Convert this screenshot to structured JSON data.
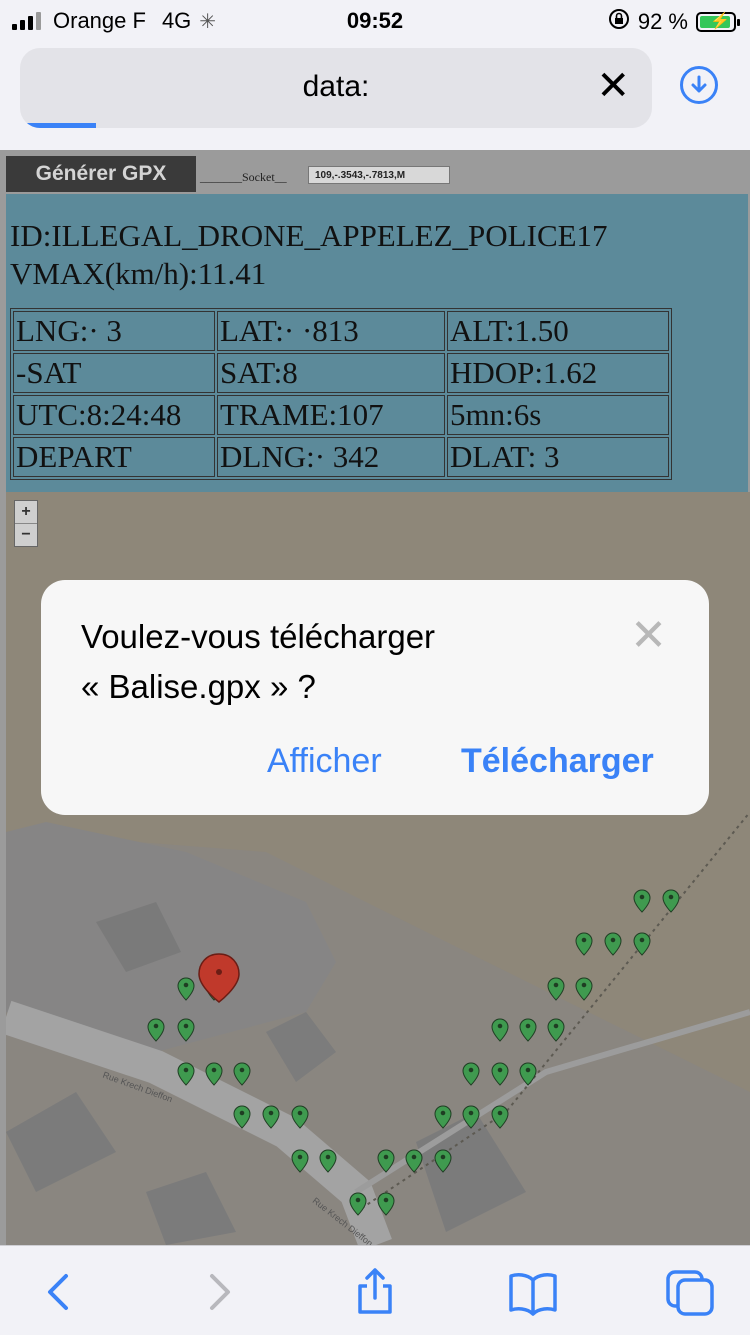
{
  "status_bar": {
    "carrier": "Orange F",
    "network": "4G",
    "time": "09:52",
    "battery_percent": "92 %",
    "battery_level": 0.92,
    "signal_bars": 3
  },
  "browser": {
    "url": "data:",
    "load_progress": 0.12,
    "accent_color": "#3a82f7"
  },
  "page": {
    "generate_button": "Générer GPX",
    "socket_label": "_______Socket__",
    "socket_value": "109,-.3543,-.7813,M",
    "drone_id": "ID:ILLEGAL_DRONE_APPELEZ_POLICE17",
    "vmax": "VMAX(km/h):11.41",
    "table": [
      [
        "LNG:·         3",
        "LAT:·   ·813",
        "ALT:1.50"
      ],
      [
        "-SAT",
        "SAT:8",
        "HDOP:1.62"
      ],
      [
        "UTC:8:24:48",
        "TRAME:107",
        "5mn:6s"
      ],
      [
        "DEPART",
        "DLNG:·    342",
        "DLAT:          3"
      ]
    ],
    "map": {
      "zoom_in": "+",
      "zoom_out": "−",
      "street_1": "Rue Krech Dieffon",
      "street_2": "Rue Krech Dieffon",
      "current_marker_color": "#c0392b",
      "track_marker_color": "#3f9a4f"
    }
  },
  "dialog": {
    "message_line1": "Voulez-vous télécharger",
    "message_line2": "« Balise.gpx » ?",
    "view_button": "Afficher",
    "download_button": "Télécharger"
  },
  "toolbar": {
    "icons": [
      "back-icon",
      "forward-icon",
      "share-icon",
      "bookmarks-icon",
      "tabs-icon"
    ]
  }
}
